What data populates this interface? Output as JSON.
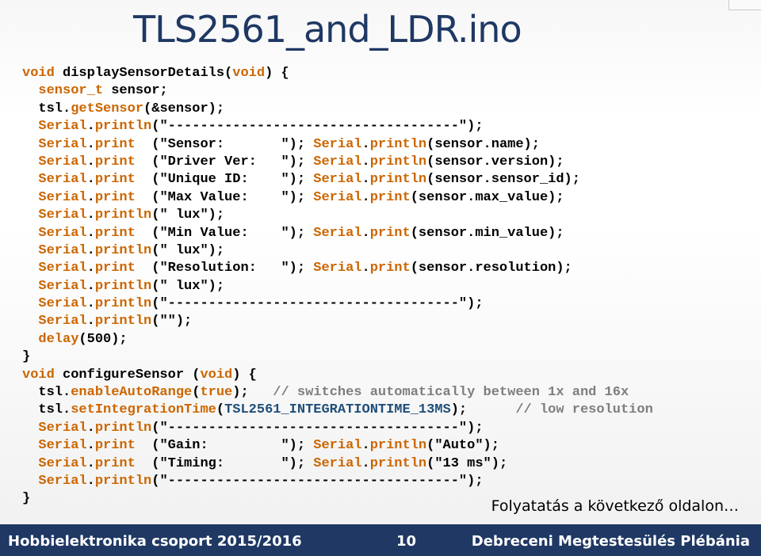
{
  "title": "TLS2561_and_LDR.ino",
  "code_lines": [
    [
      [
        "kw",
        "void"
      ],
      [
        "tx",
        " displaySensorDetails("
      ],
      [
        "kw",
        "void"
      ],
      [
        "tx",
        ") {"
      ]
    ],
    [
      [
        "tx",
        "  "
      ],
      [
        "kw",
        "sensor_t"
      ],
      [
        "tx",
        " sensor;"
      ]
    ],
    [
      [
        "tx",
        "  tsl."
      ],
      [
        "fn",
        "getSensor"
      ],
      [
        "tx",
        "(&sensor);"
      ]
    ],
    [
      [
        "tx",
        "  "
      ],
      [
        "kw",
        "Serial"
      ],
      [
        "tx",
        "."
      ],
      [
        "fn",
        "println"
      ],
      [
        "tx",
        "(\"------------------------------------\");"
      ]
    ],
    [
      [
        "tx",
        "  "
      ],
      [
        "kw",
        "Serial"
      ],
      [
        "tx",
        "."
      ],
      [
        "fn",
        "print"
      ],
      [
        "tx",
        "  (\"Sensor:       \"); "
      ],
      [
        "kw",
        "Serial"
      ],
      [
        "tx",
        "."
      ],
      [
        "fn",
        "println"
      ],
      [
        "tx",
        "(sensor.name);"
      ]
    ],
    [
      [
        "tx",
        "  "
      ],
      [
        "kw",
        "Serial"
      ],
      [
        "tx",
        "."
      ],
      [
        "fn",
        "print"
      ],
      [
        "tx",
        "  (\"Driver Ver:   \"); "
      ],
      [
        "kw",
        "Serial"
      ],
      [
        "tx",
        "."
      ],
      [
        "fn",
        "println"
      ],
      [
        "tx",
        "(sensor.version);"
      ]
    ],
    [
      [
        "tx",
        "  "
      ],
      [
        "kw",
        "Serial"
      ],
      [
        "tx",
        "."
      ],
      [
        "fn",
        "print"
      ],
      [
        "tx",
        "  (\"Unique ID:    \"); "
      ],
      [
        "kw",
        "Serial"
      ],
      [
        "tx",
        "."
      ],
      [
        "fn",
        "println"
      ],
      [
        "tx",
        "(sensor.sensor_id);"
      ]
    ],
    [
      [
        "tx",
        "  "
      ],
      [
        "kw",
        "Serial"
      ],
      [
        "tx",
        "."
      ],
      [
        "fn",
        "print"
      ],
      [
        "tx",
        "  (\"Max Value:    \"); "
      ],
      [
        "kw",
        "Serial"
      ],
      [
        "tx",
        "."
      ],
      [
        "fn",
        "print"
      ],
      [
        "tx",
        "(sensor.max_value);"
      ]
    ],
    [
      [
        "tx",
        "  "
      ],
      [
        "kw",
        "Serial"
      ],
      [
        "tx",
        "."
      ],
      [
        "fn",
        "println"
      ],
      [
        "tx",
        "(\" lux\");"
      ]
    ],
    [
      [
        "tx",
        "  "
      ],
      [
        "kw",
        "Serial"
      ],
      [
        "tx",
        "."
      ],
      [
        "fn",
        "print"
      ],
      [
        "tx",
        "  (\"Min Value:    \"); "
      ],
      [
        "kw",
        "Serial"
      ],
      [
        "tx",
        "."
      ],
      [
        "fn",
        "print"
      ],
      [
        "tx",
        "(sensor.min_value);"
      ]
    ],
    [
      [
        "tx",
        "  "
      ],
      [
        "kw",
        "Serial"
      ],
      [
        "tx",
        "."
      ],
      [
        "fn",
        "println"
      ],
      [
        "tx",
        "(\" lux\");"
      ]
    ],
    [
      [
        "tx",
        "  "
      ],
      [
        "kw",
        "Serial"
      ],
      [
        "tx",
        "."
      ],
      [
        "fn",
        "print"
      ],
      [
        "tx",
        "  (\"Resolution:   \"); "
      ],
      [
        "kw",
        "Serial"
      ],
      [
        "tx",
        "."
      ],
      [
        "fn",
        "print"
      ],
      [
        "tx",
        "(sensor.resolution);"
      ]
    ],
    [
      [
        "tx",
        "  "
      ],
      [
        "kw",
        "Serial"
      ],
      [
        "tx",
        "."
      ],
      [
        "fn",
        "println"
      ],
      [
        "tx",
        "(\" lux\");"
      ]
    ],
    [
      [
        "tx",
        "  "
      ],
      [
        "kw",
        "Serial"
      ],
      [
        "tx",
        "."
      ],
      [
        "fn",
        "println"
      ],
      [
        "tx",
        "(\"------------------------------------\");"
      ]
    ],
    [
      [
        "tx",
        "  "
      ],
      [
        "kw",
        "Serial"
      ],
      [
        "tx",
        "."
      ],
      [
        "fn",
        "println"
      ],
      [
        "tx",
        "(\"\");"
      ]
    ],
    [
      [
        "tx",
        "  "
      ],
      [
        "fn",
        "delay"
      ],
      [
        "tx",
        "(500);"
      ]
    ],
    [
      [
        "tx",
        "}"
      ]
    ],
    [
      [
        "kw",
        "void"
      ],
      [
        "tx",
        " configureSensor ("
      ],
      [
        "kw",
        "void"
      ],
      [
        "tx",
        ") {"
      ]
    ],
    [
      [
        "tx",
        "  tsl."
      ],
      [
        "fn",
        "enableAutoRange"
      ],
      [
        "tx",
        "("
      ],
      [
        "kw",
        "true"
      ],
      [
        "tx",
        ");   "
      ],
      [
        "cm",
        "// switches automatically between 1x and 16x"
      ]
    ],
    [
      [
        "tx",
        "  tsl."
      ],
      [
        "fn",
        "setIntegrationTime"
      ],
      [
        "tx",
        "("
      ],
      [
        "ct",
        "TSL2561_INTEGRATIONTIME_13MS"
      ],
      [
        "tx",
        ");      "
      ],
      [
        "cm",
        "// low resolution"
      ]
    ],
    [
      [
        "tx",
        "  "
      ],
      [
        "kw",
        "Serial"
      ],
      [
        "tx",
        "."
      ],
      [
        "fn",
        "println"
      ],
      [
        "tx",
        "(\"------------------------------------\");"
      ]
    ],
    [
      [
        "tx",
        "  "
      ],
      [
        "kw",
        "Serial"
      ],
      [
        "tx",
        "."
      ],
      [
        "fn",
        "print"
      ],
      [
        "tx",
        "  (\"Gain:         \"); "
      ],
      [
        "kw",
        "Serial"
      ],
      [
        "tx",
        "."
      ],
      [
        "fn",
        "println"
      ],
      [
        "tx",
        "(\"Auto\");"
      ]
    ],
    [
      [
        "tx",
        "  "
      ],
      [
        "kw",
        "Serial"
      ],
      [
        "tx",
        "."
      ],
      [
        "fn",
        "print"
      ],
      [
        "tx",
        "  (\"Timing:       \"); "
      ],
      [
        "kw",
        "Serial"
      ],
      [
        "tx",
        "."
      ],
      [
        "fn",
        "println"
      ],
      [
        "tx",
        "(\"13 ms\");"
      ]
    ],
    [
      [
        "tx",
        "  "
      ],
      [
        "kw",
        "Serial"
      ],
      [
        "tx",
        "."
      ],
      [
        "fn",
        "println"
      ],
      [
        "tx",
        "(\"------------------------------------\");"
      ]
    ],
    [
      [
        "tx",
        "}"
      ]
    ]
  ],
  "continue_note": "Folyatatás a következő oldalon…",
  "footer": {
    "left": "Hobbielektronika csoport 2015/2016",
    "page_number": "10",
    "right": "Debreceni Megtestesülés Plébánia"
  },
  "colors": {
    "footer_bg": "#1f3864",
    "title": "#1f3864",
    "keyword": "#cc6600",
    "comment": "#7e7e7e",
    "constant": "#1f4e79"
  }
}
